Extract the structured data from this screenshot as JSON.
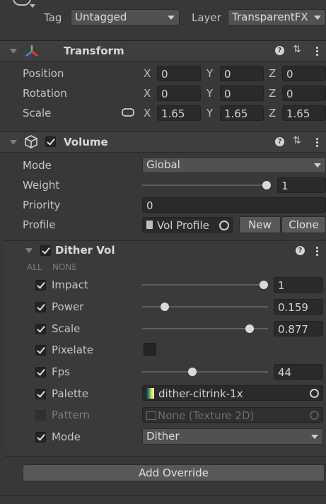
{
  "top": {
    "tag_label": "Tag",
    "tag_value": "Untagged",
    "layer_label": "Layer",
    "layer_value": "TransparentFX"
  },
  "transform": {
    "title": "Transform",
    "rows": [
      {
        "label": "Position",
        "x": "0",
        "y": "0",
        "z": "0"
      },
      {
        "label": "Rotation",
        "x": "0",
        "y": "0",
        "z": "0"
      },
      {
        "label": "Scale",
        "x": "1.65",
        "y": "1.65",
        "z": "1.65"
      }
    ],
    "axis_x": "X",
    "axis_y": "Y",
    "axis_z": "Z"
  },
  "volume": {
    "title": "Volume",
    "mode_label": "Mode",
    "mode_value": "Global",
    "weight_label": "Weight",
    "weight_value": "1",
    "weight_fraction": 1.0,
    "priority_label": "Priority",
    "priority_value": "0",
    "profile_label": "Profile",
    "profile_value": "Vol Profile",
    "new_label": "New",
    "clone_label": "Clone"
  },
  "dither": {
    "title": "Dither Vol",
    "all_label": "ALL",
    "none_label": "NONE",
    "impact_label": "Impact",
    "impact_value": "1",
    "impact_fraction": 1.0,
    "power_label": "Power",
    "power_value": "0.159",
    "power_fraction": 0.159,
    "scale_label": "Scale",
    "scale_value": "0.877",
    "scale_fraction": 0.877,
    "pixelate_label": "Pixelate",
    "fps_label": "Fps",
    "fps_value": "44",
    "fps_fraction": 0.39,
    "palette_label": "Palette",
    "palette_value": "dither-citrink-1x",
    "pattern_label": "Pattern",
    "pattern_value": "None (Texture 2D)",
    "mode_label": "Mode",
    "mode_value": "Dither"
  },
  "add_override_label": "Add Override",
  "colors": {
    "background": "#383838",
    "header": "#3e3e3e",
    "transform_red": "#e0413c",
    "transform_green": "#6cc63c",
    "transform_blue": "#3c8de0"
  }
}
